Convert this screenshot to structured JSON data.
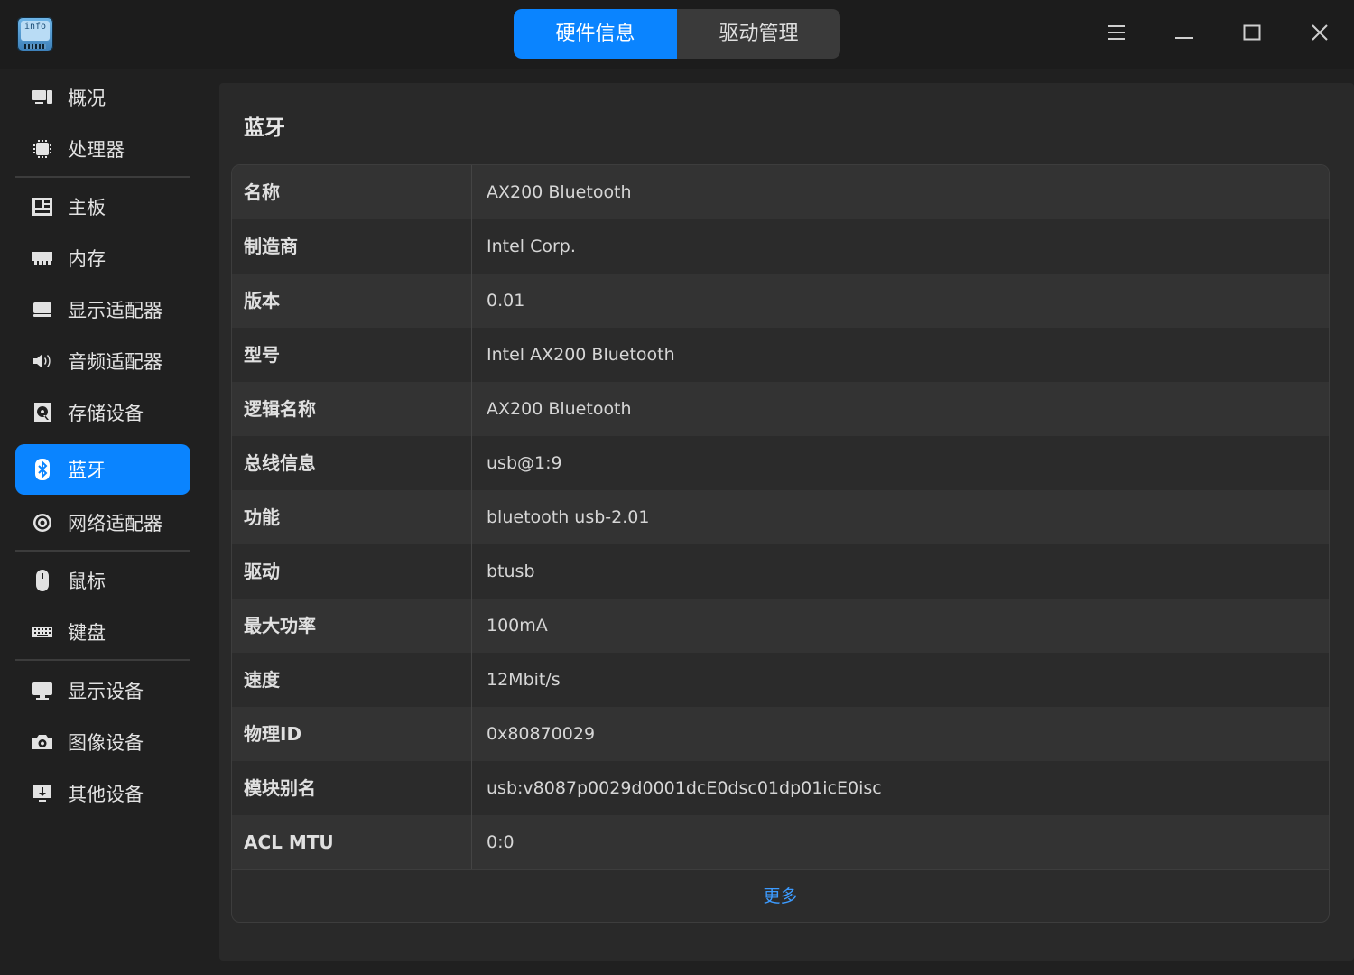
{
  "app": {
    "icon_text": "info"
  },
  "tabs": [
    {
      "label": "硬件信息",
      "active": true
    },
    {
      "label": "驱动管理",
      "active": false
    }
  ],
  "window_controls": [
    "menu-icon",
    "minimize-icon",
    "maximize-icon",
    "close-icon"
  ],
  "sidebar": {
    "items": [
      {
        "label": "概况",
        "icon": "overview-icon"
      },
      {
        "label": "处理器",
        "icon": "cpu-icon"
      },
      {
        "label": "主板",
        "icon": "motherboard-icon"
      },
      {
        "label": "内存",
        "icon": "memory-icon"
      },
      {
        "label": "显示适配器",
        "icon": "gpu-icon"
      },
      {
        "label": "音频适配器",
        "icon": "speaker-icon"
      },
      {
        "label": "存储设备",
        "icon": "storage-icon"
      },
      {
        "label": "蓝牙",
        "icon": "bluetooth-icon",
        "active": true
      },
      {
        "label": "网络适配器",
        "icon": "network-icon"
      },
      {
        "label": "鼠标",
        "icon": "mouse-icon"
      },
      {
        "label": "键盘",
        "icon": "keyboard-icon"
      },
      {
        "label": "显示设备",
        "icon": "monitor-icon"
      },
      {
        "label": "图像设备",
        "icon": "camera-icon"
      },
      {
        "label": "其他设备",
        "icon": "other-device-icon"
      }
    ]
  },
  "main": {
    "title": "蓝牙",
    "rows": [
      {
        "key": "名称",
        "value": "AX200 Bluetooth"
      },
      {
        "key": "制造商",
        "value": "Intel Corp."
      },
      {
        "key": "版本",
        "value": "0.01"
      },
      {
        "key": "型号",
        "value": "Intel AX200 Bluetooth"
      },
      {
        "key": "逻辑名称",
        "value": "AX200 Bluetooth"
      },
      {
        "key": "总线信息",
        "value": "usb@1:9"
      },
      {
        "key": "功能",
        "value": "bluetooth usb-2.01"
      },
      {
        "key": "驱动",
        "value": "btusb"
      },
      {
        "key": "最大功率",
        "value": "100mA"
      },
      {
        "key": "速度",
        "value": "12Mbit/s"
      },
      {
        "key": "物理ID",
        "value": "0x80870029"
      },
      {
        "key": "模块别名",
        "value": "usb:v8087p0029d0001dcE0dsc01dp01icE0isc"
      },
      {
        "key": "ACL MTU",
        "value": "0:0"
      }
    ],
    "more_label": "更多"
  },
  "colors": {
    "accent": "#0a84ff",
    "link": "#3c9bff",
    "background": "#202020",
    "panel": "#292929"
  }
}
